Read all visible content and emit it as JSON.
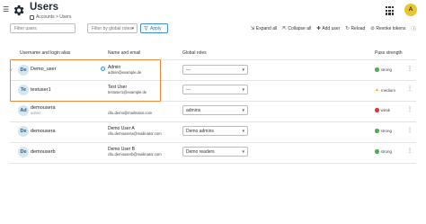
{
  "header": {
    "menu_icon": "hamburger-icon",
    "logo_icon": "gear-icon",
    "title": "Users",
    "breadcrumb": "Accounts > Users",
    "apps_icon": "apps-grid-icon",
    "avatar_initial": "A",
    "avatar_color": "#e9c531"
  },
  "toolbar": {
    "search_placeholder": "Filter users",
    "role_filter_placeholder": "Filter by global roles",
    "apply_label": "Apply",
    "expand_all": "Expand all",
    "collapse_all": "Collapse all",
    "add_user": "Add user",
    "reload": "Reload",
    "revoke_tokens": "Revoke tokens"
  },
  "table": {
    "columns": {
      "user": "Username and login alias",
      "name": "Name and email",
      "roles": "Global roles",
      "strength": "Pass strength"
    },
    "rows": [
      {
        "initials": "De",
        "username": "Demo_user",
        "alias": "",
        "expanded": "˅",
        "name": "Admin",
        "email": "admin@example.de",
        "group_icon": true,
        "role": "---",
        "strength": "strong",
        "strength_color": "#4caf50"
      },
      {
        "initials": "Te",
        "username": "testuser1",
        "alias": "",
        "name": "Test User",
        "email": "testuser1@example.de",
        "role": "---",
        "strength": "medium",
        "strength_color": "#f0a020"
      },
      {
        "initials": "Ad",
        "username": "demousera",
        "alias": "admin",
        "name": "",
        "email": "cllu.demo@mailinator.com",
        "role": "admins",
        "strength": "weak",
        "strength_color": "#d9363e"
      },
      {
        "initials": "De",
        "username": "demousera",
        "alias": "",
        "name": "Demo User A",
        "email": "cllu.demousera@mailinator.com",
        "role": "Demo admins",
        "strength": "strong",
        "strength_color": "#4caf50"
      },
      {
        "initials": "De",
        "username": "demouserb",
        "alias": "",
        "name": "Demo User B",
        "email": "cllu.demouserb@mailinator.com",
        "role": "Demo readers",
        "strength": "strong",
        "strength_color": "#4caf50"
      }
    ]
  }
}
